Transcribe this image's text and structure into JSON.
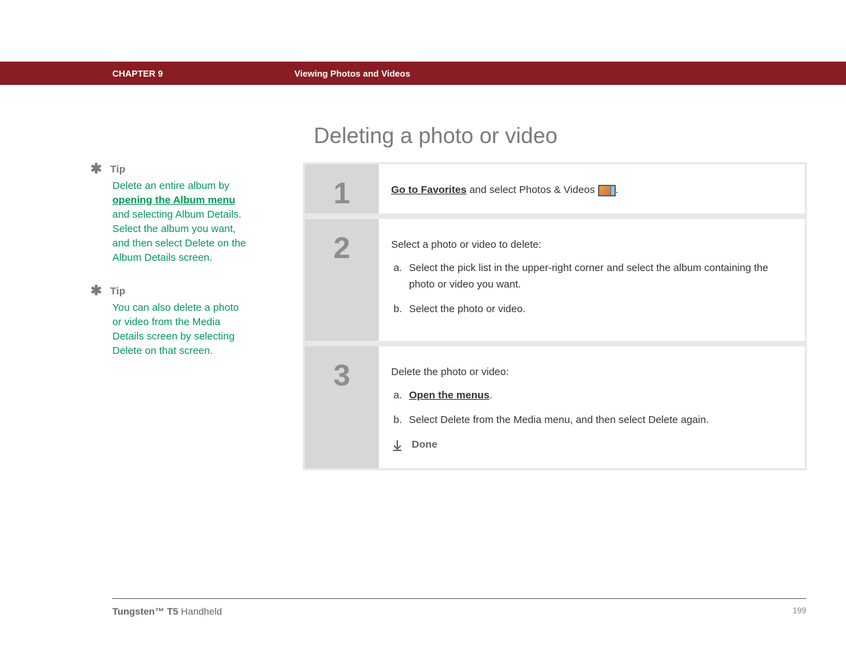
{
  "header": {
    "chapter": "CHAPTER 9",
    "title": "Viewing Photos and Videos"
  },
  "page": {
    "title": "Deleting a photo or video"
  },
  "tips": [
    {
      "label": "Tip",
      "body_pre": "Delete an entire album by ",
      "link": "opening the Album menu",
      "body_post": " and selecting Album Details. Select the album you want, and then select Delete on the Album Details screen."
    },
    {
      "label": "Tip",
      "body": "You can also delete a photo or video from the Media Details screen by selecting Delete on that screen."
    }
  ],
  "steps": {
    "step1": {
      "num": "1",
      "link": "Go to Favorites",
      "text_post": " and select Photos & Videos ",
      "period": "."
    },
    "step2": {
      "num": "2",
      "intro": "Select a photo or video to delete:",
      "a": "Select the pick list in the upper-right corner and select the album containing the photo or video you want.",
      "b": "Select the photo or video."
    },
    "step3": {
      "num": "3",
      "intro": "Delete the photo or video:",
      "a_link": "Open the menus",
      "a_post": ".",
      "b": "Select Delete from the Media menu, and then select Delete again.",
      "done": "Done"
    }
  },
  "footer": {
    "product_strong": "Tungsten™ T5",
    "product_light": " Handheld",
    "page_num": "199"
  }
}
